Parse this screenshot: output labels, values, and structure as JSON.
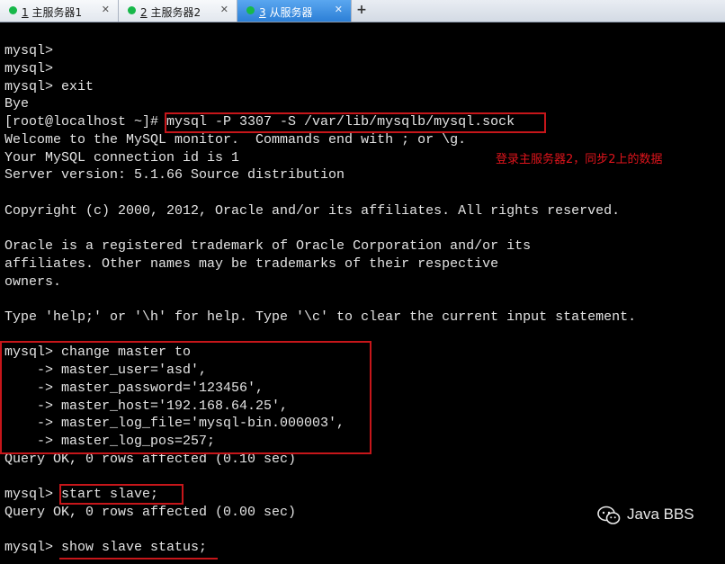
{
  "tabs": [
    {
      "number": "1",
      "label": "主服务器1",
      "active": false
    },
    {
      "number": "2",
      "label": "主服务器2",
      "active": false
    },
    {
      "number": "3",
      "label": "从服务器",
      "active": true
    }
  ],
  "new_tab_label": "+",
  "close_glyph": "✕",
  "status_dot_color": "#17b84a",
  "highlight_color": "#c6161a",
  "terminal": {
    "lines": [
      "mysql>",
      "mysql>",
      "mysql> exit",
      "Bye",
      "[root@localhost ~]# mysql -P 3307 -S /var/lib/mysqlb/mysql.sock",
      "Welcome to the MySQL monitor.  Commands end with ; or \\g.",
      "Your MySQL connection id is 1",
      "Server version: 5.1.66 Source distribution",
      "",
      "Copyright (c) 2000, 2012, Oracle and/or its affiliates. All rights reserved.",
      "",
      "Oracle is a registered trademark of Oracle Corporation and/or its",
      "affiliates. Other names may be trademarks of their respective",
      "owners.",
      "",
      "Type 'help;' or '\\h' for help. Type '\\c' to clear the current input statement.",
      "",
      "mysql> change master to",
      "    -> master_user='asd',",
      "    -> master_password='123456',",
      "    -> master_host='192.168.64.25',",
      "    -> master_log_file='mysql-bin.000003',",
      "    -> master_log_pos=257;",
      "Query OK, 0 rows affected (0.10 sec)",
      "",
      "mysql> start slave;",
      "Query OK, 0 rows affected (0.00 sec)",
      "",
      "mysql> show slave status;"
    ]
  },
  "annotation": "登录主服务器2，同步2上的数据",
  "watermark": {
    "icon": "wechat-icon",
    "text": "Java BBS"
  }
}
